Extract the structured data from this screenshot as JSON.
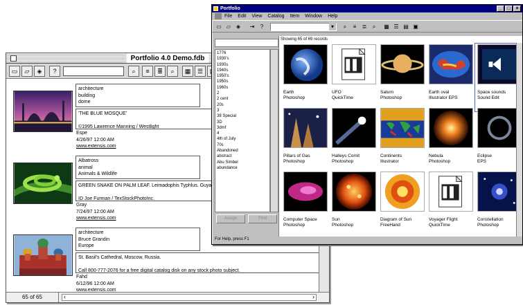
{
  "mac_window": {
    "title": "Portfolio 4.0 Demo.fdb",
    "record_count": "65 of 65",
    "records": [
      {
        "keywords": [
          "architecture",
          "building",
          "dome"
        ],
        "caption_lines": [
          "'THE BLUE MOSQUE'",
          "",
          "©1995 Lawrence Manning / Westlight"
        ],
        "photographer": "Espe",
        "date": "4/26/97 12:00 AM",
        "url": "www.extensis.com"
      },
      {
        "keywords": [
          "Albatross",
          "animal",
          "Animals & Wildlife"
        ],
        "caption_lines": [
          "GREEN SNAKE ON PALM LEAF. Leimadophis Typhlus. Guya",
          "",
          "ID Joe Furman / TexStockPhotoInc."
        ],
        "photographer": "Gray",
        "date": "7/24/97 12:00 AM",
        "url": "www.extensis.com"
      },
      {
        "keywords": [
          "architecture",
          "Bruce Grandin",
          "Europe"
        ],
        "caption_lines": [
          "St. Basil's Cathedral, Moscow, Russia.",
          "",
          "Call 800-777-2076 for a free digital catalog disk on any stock photo subject."
        ],
        "photographer": "Fahd",
        "date": "6/12/96 12:00 AM",
        "url": "www.extensis.com"
      }
    ]
  },
  "win_window": {
    "title": "Portfolio",
    "menu": [
      "File",
      "Edit",
      "View",
      "Catalog",
      "Item",
      "Window",
      "Help"
    ],
    "showing": "Showing 65 of 69 records",
    "keywords": [
      "1776",
      "1930's",
      "1930s",
      "1940s",
      "1950's",
      "1950s",
      "1960s",
      "2",
      "2 cent",
      "20s",
      "3",
      "38 Special",
      "3D",
      "3dmf",
      "4",
      "4th of July",
      "70s",
      "Abandoned",
      "abstract",
      "Abu Simbel",
      "abundance"
    ],
    "kw_buttons": [
      "Assign",
      "Find"
    ],
    "status": "For Help, press F1",
    "tiles": [
      {
        "name": "Earth",
        "type": "Photoshop"
      },
      {
        "name": "UFO",
        "type": "QuickTime"
      },
      {
        "name": "Saturn",
        "type": "Photoshop"
      },
      {
        "name": "Earth oval",
        "type": "Illustrator EPS"
      },
      {
        "name": "Space sounds",
        "type": "Sound Edit"
      },
      {
        "name": "Pillars of Gas",
        "type": "Photoshop"
      },
      {
        "name": "Halleys Comit",
        "type": "Photoshop"
      },
      {
        "name": "Continents",
        "type": "Illustrator"
      },
      {
        "name": "Nebula",
        "type": "Photoshop"
      },
      {
        "name": "Eclipse",
        "type": "EPS"
      },
      {
        "name": "Computer Space",
        "type": "Photoshop"
      },
      {
        "name": "Sun",
        "type": "Photoshop"
      },
      {
        "name": "Diagram of Sun",
        "type": "FreeHand"
      },
      {
        "name": "Voyager Flight",
        "type": "QuickTime"
      },
      {
        "name": "Constellation",
        "type": "Photoshop"
      }
    ]
  }
}
